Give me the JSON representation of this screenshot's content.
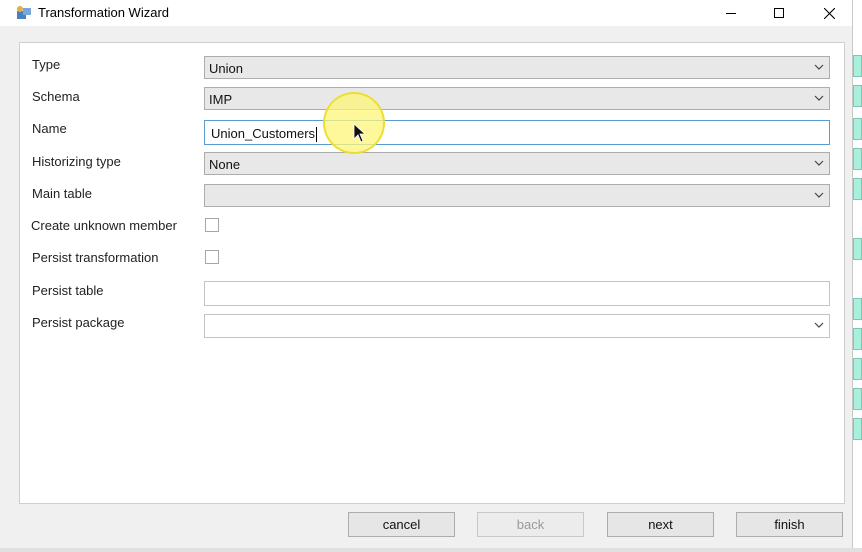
{
  "window": {
    "title": "Transformation Wizard",
    "icons": {
      "app": "wizard-app-icon",
      "minimize": "minimize-icon",
      "maximize": "maximize-icon",
      "close": "close-icon"
    }
  },
  "form": {
    "type": {
      "label": "Type",
      "value": "Union"
    },
    "schema": {
      "label": "Schema",
      "value": "IMP"
    },
    "name": {
      "label": "Name",
      "value": "Union_Customers"
    },
    "historizing_type": {
      "label": "Historizing type",
      "value": "None"
    },
    "main_table": {
      "label": "Main table",
      "value": ""
    },
    "create_unknown_member": {
      "label": "Create unknown member",
      "checked": false
    },
    "persist_transformation": {
      "label": "Persist transformation",
      "checked": false
    },
    "persist_table": {
      "label": "Persist table",
      "value": ""
    },
    "persist_package": {
      "label": "Persist package",
      "value": ""
    }
  },
  "buttons": {
    "cancel": "cancel",
    "back": "back",
    "next": "next",
    "finish": "finish"
  },
  "colors": {
    "accent_border": "#5b9bd5",
    "cursor_highlight": "#fff578",
    "backdrop_tile": "#a8f0dc"
  }
}
